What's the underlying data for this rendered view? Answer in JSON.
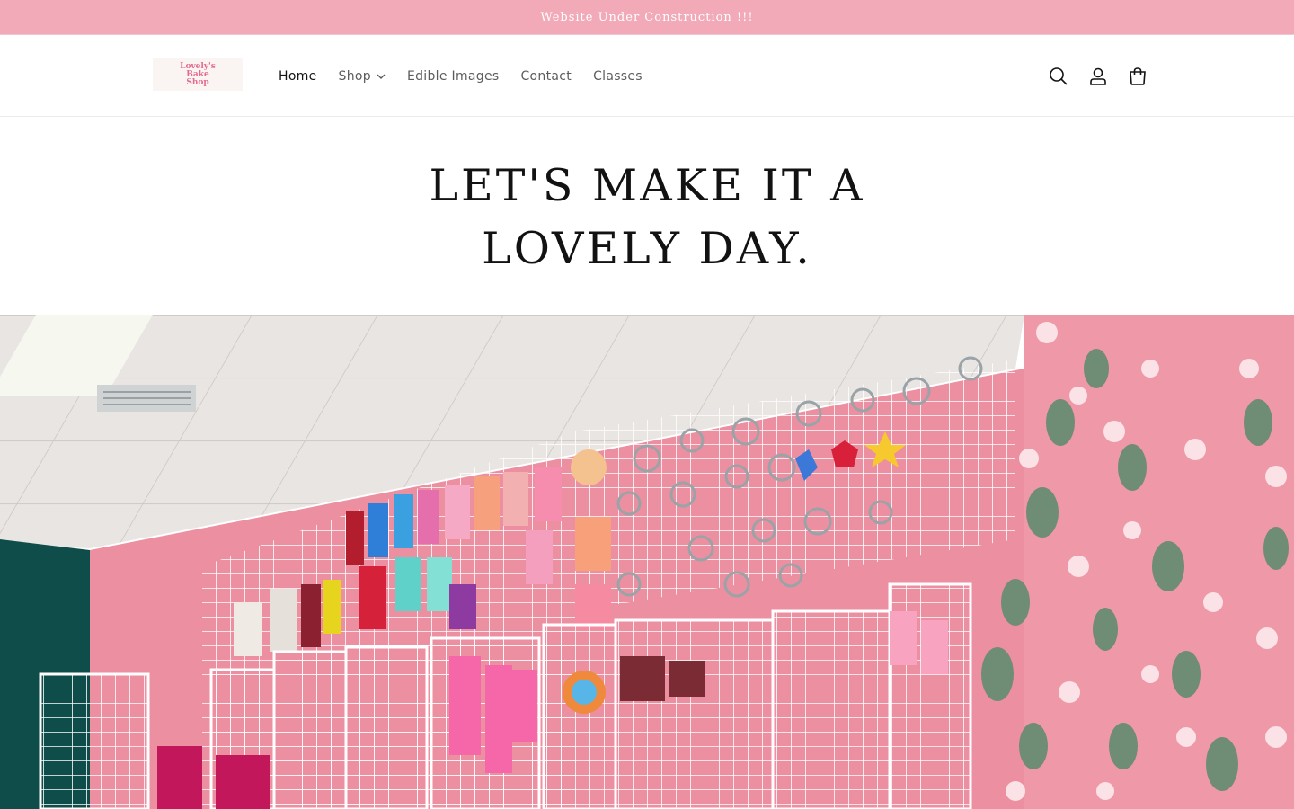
{
  "announcement": {
    "text": "Website Under Construction !!!"
  },
  "header": {
    "logo": {
      "line1": "Lovely's",
      "line2": "Bake",
      "line3": "Shop",
      "alt": "Lovely's Bake Shop"
    },
    "nav": [
      {
        "label": "Home",
        "active": true
      },
      {
        "label": "Shop",
        "has_dropdown": true
      },
      {
        "label": "Edible Images"
      },
      {
        "label": "Contact"
      },
      {
        "label": "Classes"
      }
    ],
    "icons": [
      "search-icon",
      "account-icon",
      "cart-icon"
    ]
  },
  "hero": {
    "heading": "LET'S MAKE IT A LOVELY DAY.",
    "image_description": "photo-of-bake-shop-interior"
  },
  "colors": {
    "announcement_bg": "#f2a9b8",
    "wall_pink": "#ec8fa0",
    "accent_pink": "#e46a8f",
    "text": "#121212"
  }
}
